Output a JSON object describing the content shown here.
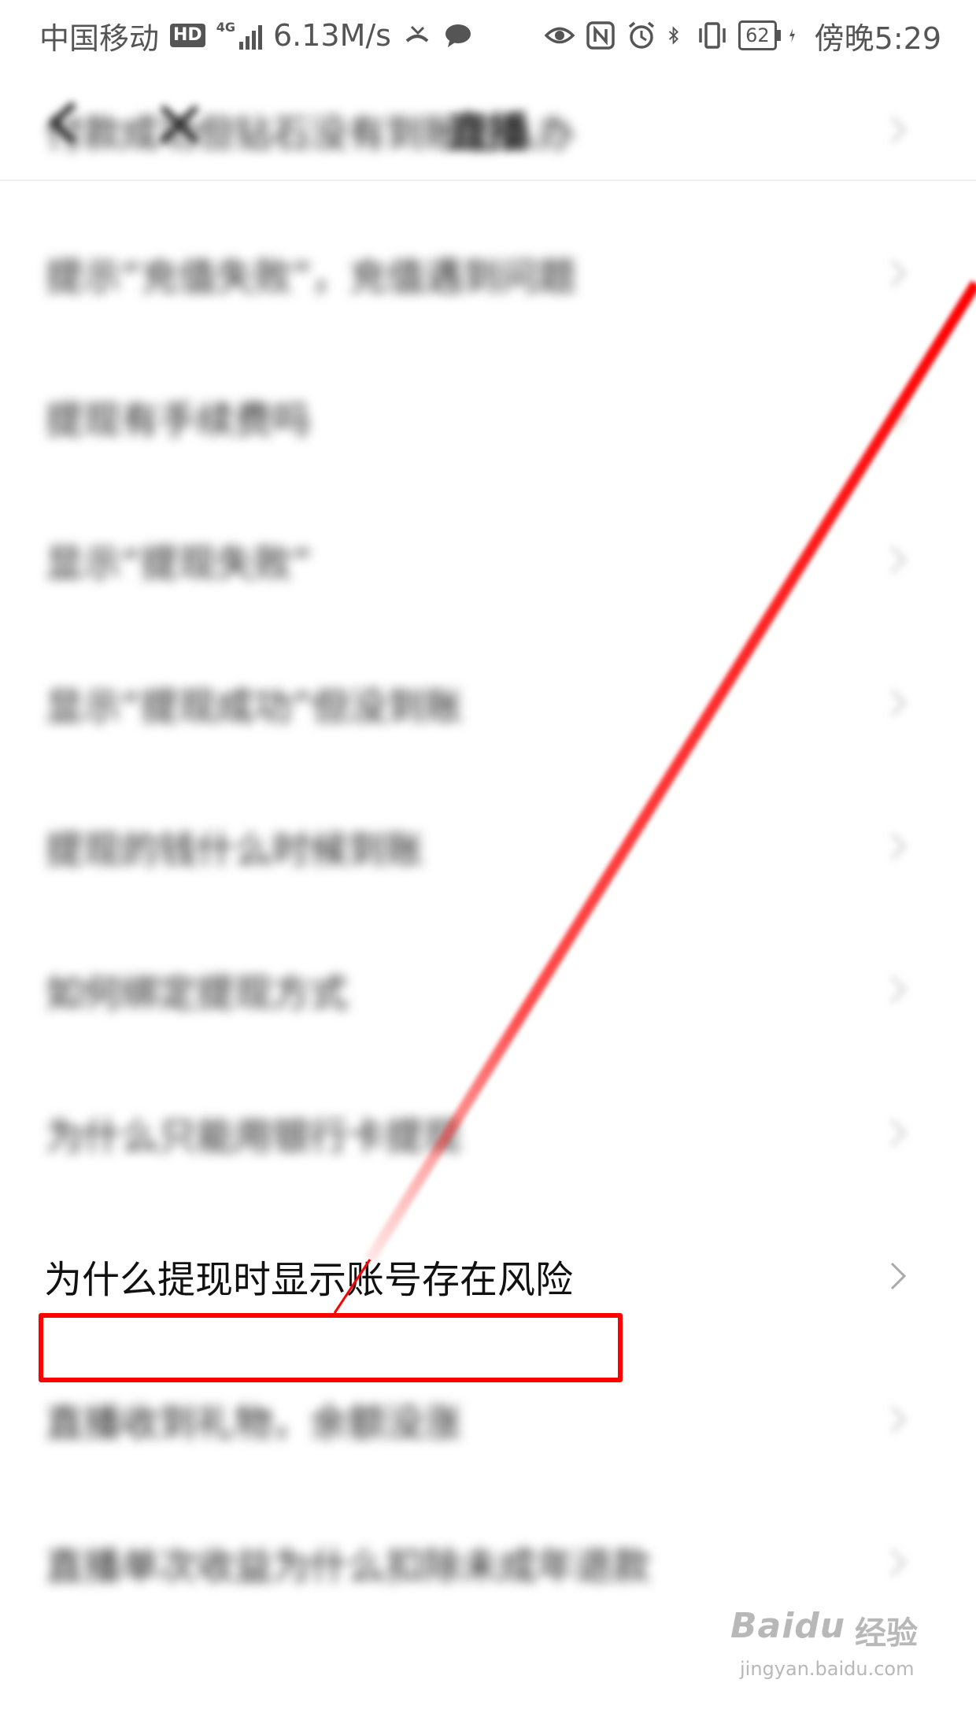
{
  "status_bar": {
    "carrier": "中国移动",
    "hd": "HD",
    "network_type": "4G",
    "speed": "6.13M/s",
    "battery": "62",
    "time": "傍晚5:29",
    "icons": [
      "missed-call-icon",
      "chat-icon",
      "eye-icon",
      "nfc-icon",
      "alarm-icon",
      "bluetooth-icon",
      "vibrate-icon",
      "battery-icon",
      "charging-icon"
    ]
  },
  "header": {
    "title": "直播",
    "back_icon": "back-arrow-icon",
    "close_icon": "close-icon"
  },
  "faq_items": [
    {
      "label": "付款成功但钻石没有到账怎么办"
    },
    {
      "label": "提示“充值失败”，充值遇到问题"
    },
    {
      "label": "提现有手续费吗"
    },
    {
      "label": "显示“提现失败”"
    },
    {
      "label": "显示“提现成功”但没到账"
    },
    {
      "label": "提现的钱什么时候到账"
    },
    {
      "label": "如何绑定提现方式"
    },
    {
      "label": "为什么只能用银行卡提现"
    },
    {
      "label": "为什么提现时显示账号存在风险"
    },
    {
      "label": "直播收到礼物，余额没涨"
    },
    {
      "label": "直播单次收益为什么扣除未成年退款"
    }
  ],
  "focused_index": 8,
  "annotation": {
    "color": "#ff0000"
  },
  "watermark": {
    "logo": "Baidu",
    "label": "经验",
    "url": "jingyan.baidu.com"
  }
}
